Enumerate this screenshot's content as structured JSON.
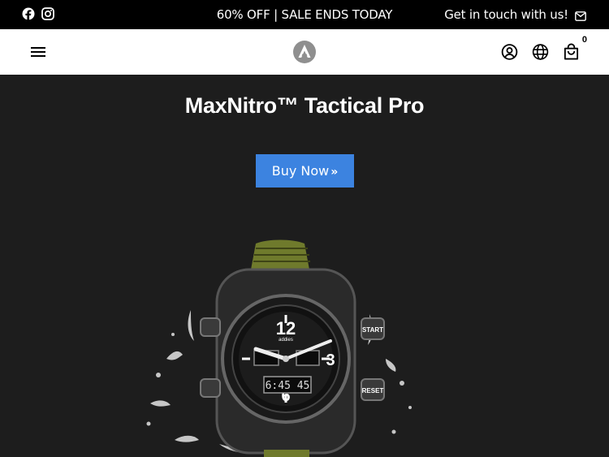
{
  "topbar": {
    "social": [
      {
        "name": "facebook",
        "icon": "facebook-icon"
      },
      {
        "name": "instagram",
        "icon": "instagram-icon"
      }
    ],
    "promo_text": "60% OFF | SALE ENDS TODAY",
    "contact_text": "Get in touch with us!",
    "contact_icon": "mail-icon"
  },
  "header": {
    "menu_icon": "hamburger-menu-icon",
    "logo_icon": "brand-logo-icon",
    "account_icon": "user-account-icon",
    "language_icon": "globe-icon",
    "cart_icon": "shopping-bag-icon",
    "cart_count": "0"
  },
  "hero": {
    "title": "MaxNitro™ Tactical Pro",
    "cta_label": "Buy Now",
    "cta_icon": "double-chevron-right-icon",
    "product_image": "tactical-watch-splash",
    "background": "#1d1d1d",
    "accent": "#3c83e0"
  },
  "watch": {
    "brand": "addies",
    "digital_time": "6:45 45",
    "buttons": [
      "START",
      "RESET"
    ],
    "strap_color": "#6f7a2c"
  }
}
